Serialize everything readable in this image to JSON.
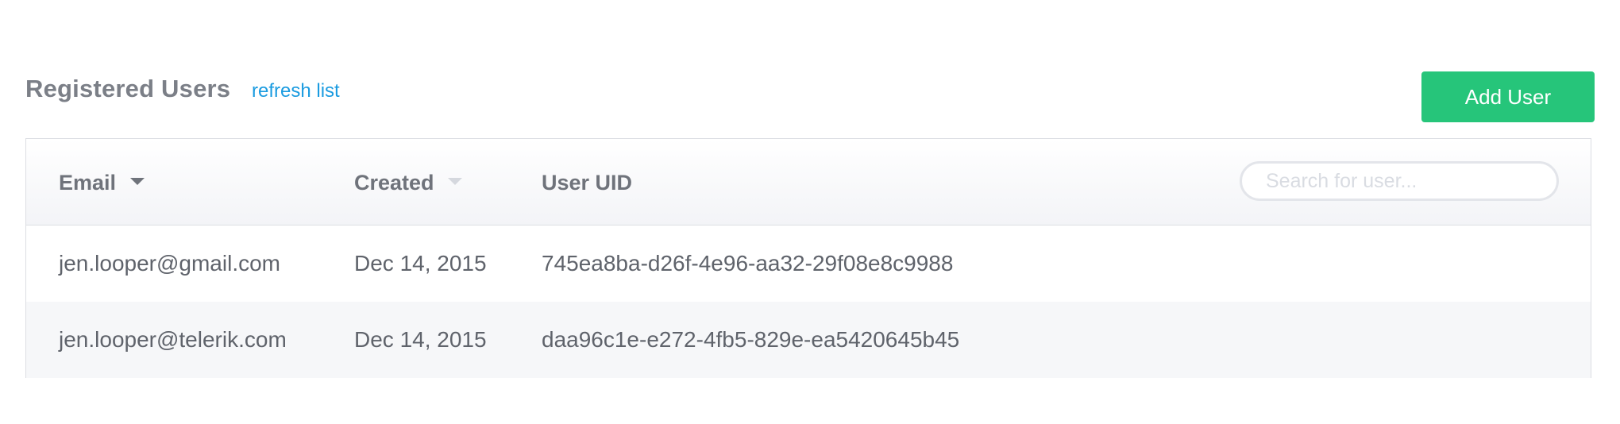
{
  "header": {
    "title": "Registered Users",
    "refresh_label": "refresh list",
    "add_user_label": "Add User"
  },
  "table": {
    "columns": {
      "email": "Email",
      "created": "Created",
      "uid": "User UID"
    },
    "search_placeholder": "Search for user...",
    "sort": {
      "active_column": "email",
      "direction": "descending"
    },
    "rows": [
      {
        "email": "jen.looper@gmail.com",
        "created": "Dec 14, 2015",
        "uid": "745ea8ba-d26f-4e96-aa32-29f08e8c9988"
      },
      {
        "email": "jen.looper@telerik.com",
        "created": "Dec 14, 2015",
        "uid": "daa96c1e-e272-4fb5-829e-ea5420645b45"
      }
    ]
  },
  "colors": {
    "accent_green": "#26c57a",
    "link_blue": "#1a9be0",
    "title_gray": "#7b7f87",
    "border": "#dcdee3"
  }
}
